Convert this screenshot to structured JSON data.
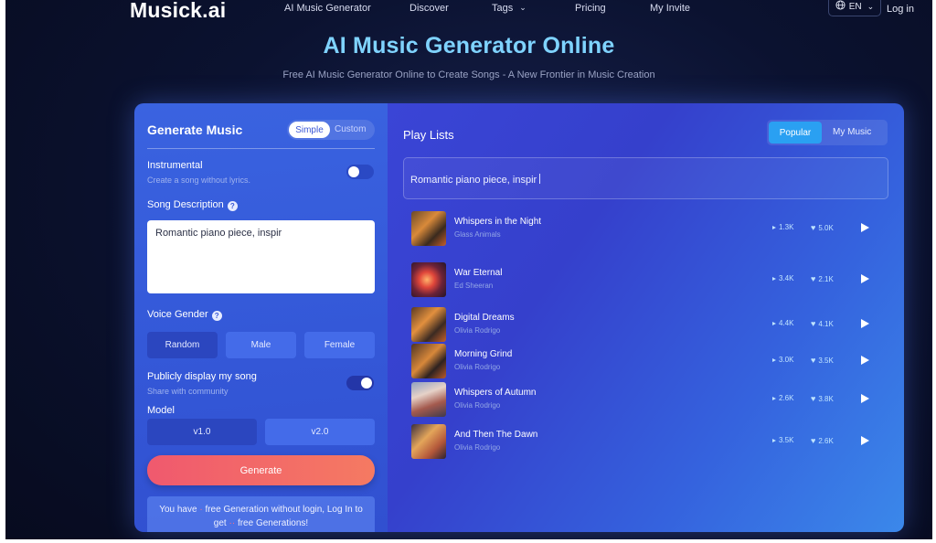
{
  "nav": {
    "logo": "Musick.ai",
    "links": [
      "AI Music Generator",
      "Discover",
      "Tags",
      "Pricing",
      "My Invite"
    ],
    "lang": "EN",
    "login": "Log in"
  },
  "hero": {
    "title": "AI Music Generator Online",
    "subtitle": "Free AI Music Generator Online to Create Songs - A New Frontier in Music Creation"
  },
  "generator": {
    "title": "Generate Music",
    "mode_simple": "Simple",
    "mode_custom": "Custom",
    "instrumental_label": "Instrumental",
    "instrumental_hint": "Create a song without lyrics.",
    "song_description_label": "Song Description",
    "song_description_value": "Romantic piano piece, inspir",
    "voice_gender_label": "Voice Gender",
    "voice_options": [
      "Random",
      "Male",
      "Female"
    ],
    "public_label": "Publicly display my song",
    "public_hint": "Share with community",
    "model_label": "Model",
    "model_options": [
      "v1.0",
      "v2.0"
    ],
    "generate_label": "Generate",
    "free_line1_a": "You have",
    "free_line1_b": "free Generation without login, Log In to",
    "free_line2_a": "get",
    "free_line2_b": "free Generations!",
    "help_glyph": "?"
  },
  "playlist": {
    "title": "Play Lists",
    "tab_popular": "Popular",
    "tab_my": "My Music",
    "search_value": "Romantic piano piece, inspir",
    "tracks": [
      {
        "title": "Whispers in the Night",
        "artist": "Glass Animals",
        "plays": "1.3K",
        "likes": "5.0K"
      },
      {
        "title": "War Eternal",
        "artist": "Ed Sheeran",
        "plays": "3.4K",
        "likes": "2.1K"
      },
      {
        "title": "Digital Dreams",
        "artist": "Olivia Rodrigo",
        "plays": "4.4K",
        "likes": "4.1K"
      },
      {
        "title": "Morning Grind",
        "artist": "Olivia Rodrigo",
        "plays": "3.0K",
        "likes": "3.5K"
      },
      {
        "title": "Whispers of Autumn",
        "artist": "Olivia Rodrigo",
        "plays": "2.6K",
        "likes": "3.8K"
      },
      {
        "title": "And Then The Dawn",
        "artist": "Olivia Rodrigo",
        "plays": "3.5K",
        "likes": "2.6K"
      }
    ]
  },
  "colors": {
    "accent": "#7fd3ff",
    "generate_start": "#f0596e",
    "generate_end": "#f57a62",
    "popular_tab": "#2aa0f2"
  }
}
